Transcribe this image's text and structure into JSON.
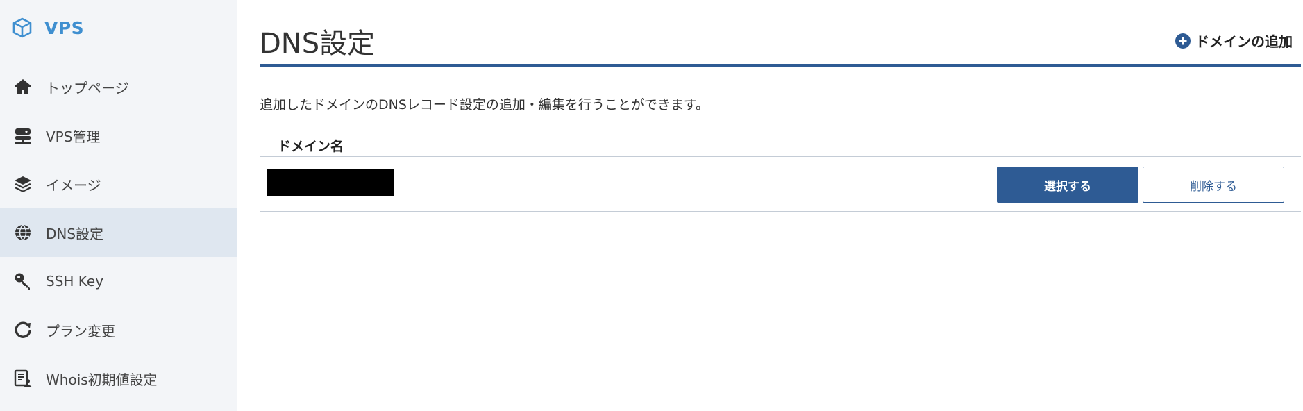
{
  "sidebar": {
    "brand": {
      "label": "VPS",
      "icon": "cube-icon"
    },
    "items": [
      {
        "label": "トップページ",
        "icon": "home-icon",
        "active": false
      },
      {
        "label": "VPS管理",
        "icon": "server-icon",
        "active": false
      },
      {
        "label": "イメージ",
        "icon": "layers-icon",
        "active": false
      },
      {
        "label": "DNS設定",
        "icon": "globe-icon",
        "active": true
      },
      {
        "label": "SSH Key",
        "icon": "key-icon",
        "active": false
      },
      {
        "label": "プラン変更",
        "icon": "refresh-icon",
        "active": false
      },
      {
        "label": "Whois初期値設定",
        "icon": "whois-icon",
        "active": false
      }
    ]
  },
  "main": {
    "title": "DNS設定",
    "add_domain_label": "ドメインの追加",
    "description": "追加したドメインのDNSレコード設定の追加・編集を行うことができます。",
    "table": {
      "column_header": "ドメイン名",
      "rows": [
        {
          "domain": "",
          "redacted": true,
          "select_label": "選択する",
          "delete_label": "削除する"
        }
      ]
    }
  },
  "colors": {
    "accent": "#2e5b94",
    "brand": "#3f8fd0",
    "sidebar_bg": "#f3f5f8",
    "active_bg": "#dfe7f0"
  }
}
